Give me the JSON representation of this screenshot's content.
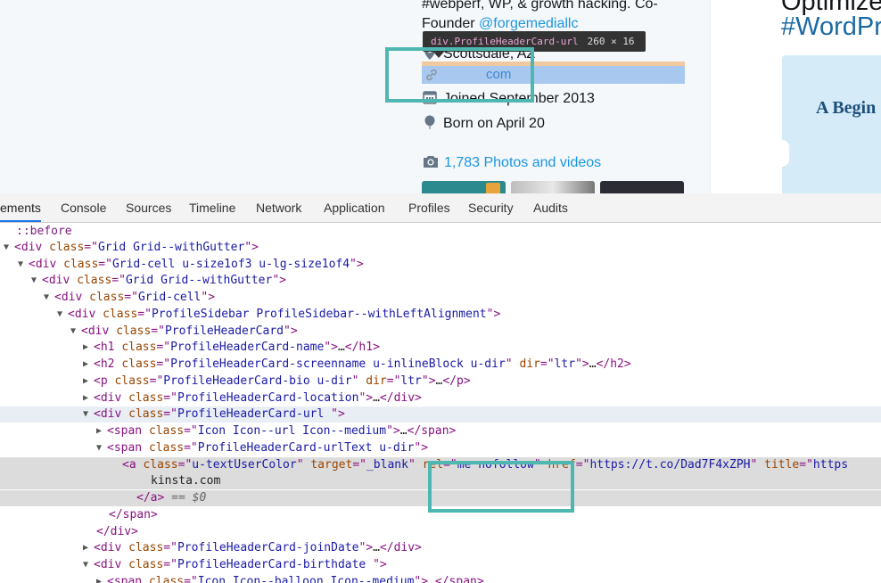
{
  "webpage": {
    "bio_line1": "#webperf, WP, & growth hacking. Co-",
    "bio_line2_prefix": "Founder ",
    "bio_link": "@forgemediallc",
    "location": "Scottsdale, AZ",
    "url_text": "com",
    "joined": "Joined September 2013",
    "born": "Born on April 20",
    "photos": "1,783 Photos and videos",
    "heading_top": "Optimize",
    "heading_hashtag": "#WordPr",
    "ad_text": "A Begin"
  },
  "tooltip": {
    "selector": "div.ProfileHeaderCard-url",
    "dimensions": "260 × 16"
  },
  "devtools": {
    "tabs": [
      "ements",
      "Console",
      "Sources",
      "Timeline",
      "Network",
      "Application",
      "Profiles",
      "Security",
      "Audits"
    ],
    "active_tab": "Elements"
  },
  "dom_tree": [
    {
      "text": "::before"
    },
    {
      "tag": "div",
      "class": "Grid Grid--withGutter",
      "expanded": true
    },
    {
      "tag": "div",
      "class": "Grid-cell u-size1of3 u-lg-size1of4",
      "expanded": true
    },
    {
      "tag": "div",
      "class": "Grid Grid--withGutter",
      "expanded": true
    },
    {
      "tag": "div",
      "class": "Grid-cell",
      "expanded": true
    },
    {
      "tag": "div",
      "class": "ProfileSidebar ProfileSidebar--withLeftAlignment",
      "expanded": true
    },
    {
      "tag": "div",
      "class": "ProfileHeaderCard",
      "expanded": true
    },
    {
      "tag": "h1",
      "class": "ProfileHeaderCard-name",
      "collapsed": true
    },
    {
      "tag": "h2",
      "class": "ProfileHeaderCard-screenname u-inlineBlock u-dir",
      "dir": "ltr",
      "collapsed": true
    },
    {
      "tag": "p",
      "class": "ProfileHeaderCard-bio u-dir",
      "dir": "ltr",
      "collapsed": true
    },
    {
      "tag": "div",
      "class": "ProfileHeaderCard-location",
      "collapsed": true
    },
    {
      "tag": "div",
      "class": "ProfileHeaderCard-url ",
      "expanded": true
    },
    {
      "tag": "span",
      "class": "Icon Icon--url Icon--medium",
      "collapsed": true
    },
    {
      "tag": "span",
      "class": "ProfileHeaderCard-urlText u-dir",
      "partial": true
    },
    {
      "tag": "a",
      "class": "u-textUserColor",
      "target": "_blank",
      "rel": "me nofollow",
      "href": "https://t.co/Dad7F4xZPH",
      "title_partial": "https"
    },
    {
      "text": "kinsta.com"
    },
    {
      "close": "a",
      "suffix": " == $0"
    },
    {
      "close": "span"
    },
    {
      "close": "div"
    },
    {
      "tag": "div",
      "class": "ProfileHeaderCard-joinDate",
      "collapsed": true
    },
    {
      "tag": "div",
      "class": "ProfileHeaderCard-birthdate ",
      "expanded": true
    },
    {
      "tag": "span",
      "class": "Icon Icon--balloon Icon--medium",
      "collapsed": true
    }
  ],
  "colors": {
    "highlight": "#4fb7b2",
    "twitter_blue": "#1b95e0",
    "tag": "#881280",
    "attr_name": "#994500",
    "attr_value": "#1a1aa6"
  }
}
